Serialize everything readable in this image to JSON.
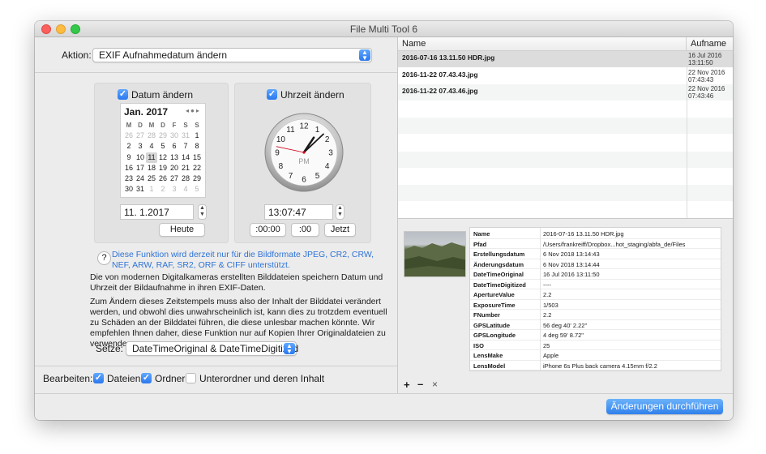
{
  "window": {
    "title": "File Multi Tool 6"
  },
  "action": {
    "label": "Aktion:",
    "value": "EXIF Aufnahmedatum ändern"
  },
  "date_panel": {
    "checkbox_label": "Datum ändern",
    "month_title": "Jan. 2017",
    "weekday_headers": [
      "M",
      "D",
      "M",
      "D",
      "F",
      "S",
      "S"
    ],
    "weeks": [
      [
        "26",
        "27",
        "28",
        "29",
        "30",
        "31",
        "1"
      ],
      [
        "2",
        "3",
        "4",
        "5",
        "6",
        "7",
        "8"
      ],
      [
        "9",
        "10",
        "11",
        "12",
        "13",
        "14",
        "15"
      ],
      [
        "16",
        "17",
        "18",
        "19",
        "20",
        "21",
        "22"
      ],
      [
        "23",
        "24",
        "25",
        "26",
        "27",
        "28",
        "29"
      ],
      [
        "30",
        "31",
        "1",
        "2",
        "3",
        "4",
        "5"
      ]
    ],
    "date_value": "11. 1.2017",
    "today_button": "Heute"
  },
  "time_panel": {
    "checkbox_label": "Uhrzeit ändern",
    "clock": {
      "hour": 1,
      "minute": 7,
      "second": 47,
      "period": "PM",
      "numbers": [
        "12",
        "1",
        "2",
        "3",
        "4",
        "5",
        "6",
        "7",
        "8",
        "9",
        "10",
        "11"
      ]
    },
    "time_value": "13:07:47",
    "btn_zero": ":00:00",
    "btn_zero_sec": ":00",
    "btn_now": "Jetzt"
  },
  "info": {
    "note": "Diese Funktion wird derzeit nur für die Bildformate JPEG, CR2, CRW, NEF, ARW, RAF, SR2, ORF & CIFF unterstützt.",
    "para1": "Die von modernen Digitalkameras erstellten Bilddateien speichern Datum und Uhrzeit der Bildaufnahme in ihren EXIF-Daten.",
    "para2": "Zum Ändern dieses Zeitstempels muss also der Inhalt der Bilddatei verändert werden, und obwohl dies unwahrscheinlich ist, kann dies zu trotzdem eventuell zu Schäden an der Bilddatei führen, die diese unlesbar machen könnte. Wir empfehlen Ihnen daher, diese Funktion nur auf Kopien Ihrer Originaldateien zu verwenden."
  },
  "setze": {
    "label": "Setze:",
    "value": "DateTimeOriginal & DateTimeDigitized"
  },
  "bearbeiten": {
    "label": "Bearbeiten:",
    "dateien": "Dateien",
    "ordner": "Ordner",
    "unterordner": "Unterordner und deren Inhalt"
  },
  "files": {
    "col_name": "Name",
    "col_aufname": "Aufname",
    "rows": [
      {
        "name": "2016-07-16 13.11.50 HDR.jpg",
        "date1": "16 Jul 2016",
        "date2": "13:11:50"
      },
      {
        "name": "2016-11-22 07.43.43.jpg",
        "date1": "22 Nov 2016",
        "date2": "07:43:43"
      },
      {
        "name": "2016-11-22 07.43.46.jpg",
        "date1": "22 Nov 2016",
        "date2": "07:43:46"
      }
    ]
  },
  "metadata": [
    {
      "key": "Name",
      "value": "2016-07-16 13.11.50 HDR.jpg"
    },
    {
      "key": "Pfad",
      "value": "/Users/frankreiff/Dropbox...hot_staging/abfa_de/Files"
    },
    {
      "key": "Erstellungsdatum",
      "value": "6 Nov 2018 13:14:43"
    },
    {
      "key": "Änderungsdatum",
      "value": "6 Nov 2018 13:14:44"
    },
    {
      "key": "DateTimeOriginal",
      "value": "16 Jul 2016 13:11:50"
    },
    {
      "key": "DateTimeDigitized",
      "value": "----"
    },
    {
      "key": "ApertureValue",
      "value": "2.2"
    },
    {
      "key": "ExposureTime",
      "value": "1/503"
    },
    {
      "key": "FNumber",
      "value": "2.2"
    },
    {
      "key": "GPSLatitude",
      "value": "56 deg 40' 2.22\""
    },
    {
      "key": "GPSLongitude",
      "value": "4 deg 59' 8.72\""
    },
    {
      "key": "ISO",
      "value": "25"
    },
    {
      "key": "LensMake",
      "value": "Apple"
    },
    {
      "key": "LensModel",
      "value": "iPhone 6s Plus back camera 4.15mm f/2.2"
    }
  ],
  "list_controls": {
    "add": "+",
    "remove": "–",
    "clear": "×"
  },
  "apply_button": "Änderungen durchführen",
  "colors": {
    "accent": "#2f80ec",
    "link": "#2f73d6",
    "second_hand": "#d0021b"
  }
}
